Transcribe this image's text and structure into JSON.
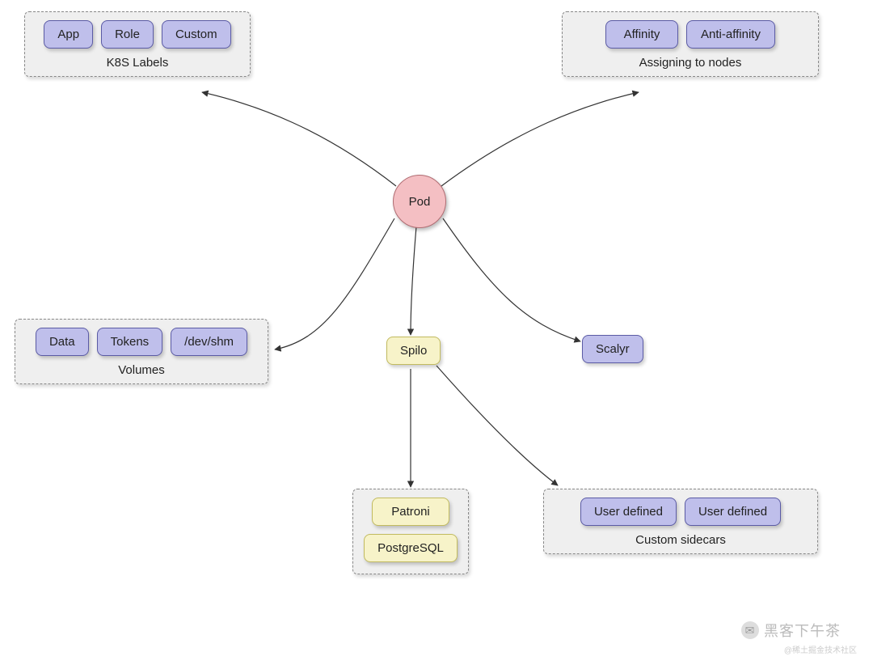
{
  "pod": "Pod",
  "groups": {
    "labels": {
      "caption": "K8S Labels",
      "items": [
        "App",
        "Role",
        "Custom"
      ]
    },
    "assign": {
      "caption": "Assigning to nodes",
      "items": [
        "Affinity",
        "Anti-affinity"
      ]
    },
    "volumes": {
      "caption": "Volumes",
      "items": [
        "Data",
        "Tokens",
        "/dev/shm"
      ]
    },
    "spilo_in": {
      "caption": "",
      "items": [
        "Patroni",
        "PostgreSQL"
      ]
    },
    "sidecars": {
      "caption": "Custom sidecars",
      "items": [
        "User defined",
        "User defined"
      ]
    }
  },
  "nodes": {
    "spilo": "Spilo",
    "scalyr": "Scalyr"
  },
  "watermark": "黑客下午茶",
  "subwatermark": "@稀土掘金技术社区"
}
